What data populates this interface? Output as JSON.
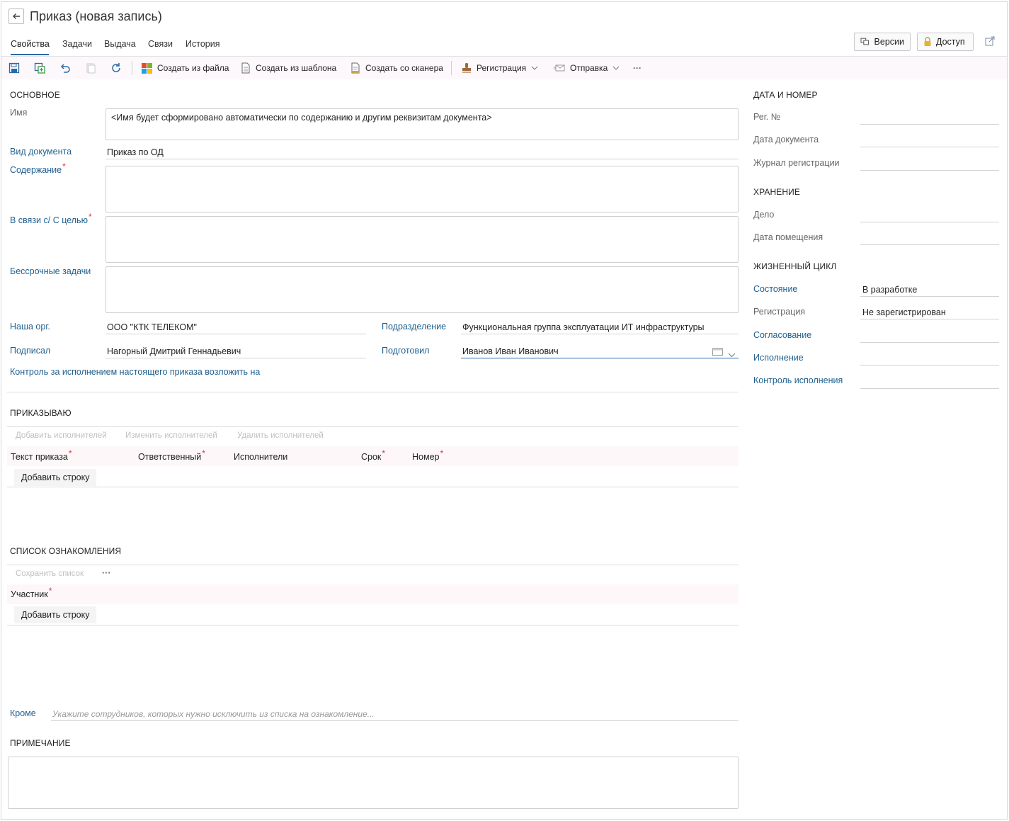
{
  "header": {
    "title": "Приказ (новая запись)",
    "versions_label": "Версии",
    "access_label": "Доступ"
  },
  "tabs": [
    {
      "label": "Свойства",
      "active": true
    },
    {
      "label": "Задачи"
    },
    {
      "label": "Выдача"
    },
    {
      "label": "Связи"
    },
    {
      "label": "История"
    }
  ],
  "toolbar": {
    "create_from_file": "Создать из файла",
    "create_from_template": "Создать из шаблона",
    "create_from_scanner": "Создать со сканера",
    "registration": "Регистрация",
    "sending": "Отправка",
    "more": "···"
  },
  "main": {
    "section_title": "ОСНОВНОЕ",
    "name_label": "Имя",
    "name_value": "<Имя будет сформировано автоматически по содержанию и другим реквизитам документа>",
    "doc_kind_label": "Вид документа",
    "doc_kind_value": "Приказ по ОД",
    "content_label": "Содержание",
    "purpose_label": "В связи с/ С целью",
    "perpetual_tasks_label": "Бессрочные задачи",
    "our_org_label": "Наша орг.",
    "our_org_value": "ООО \"КТК ТЕЛЕКОМ\"",
    "department_label": "Подразделение",
    "department_value": "Функциональная группа эксплуатации ИТ инфраструктуры",
    "signed_label": "Подписал",
    "signed_value": "Нагорный Дмитрий Геннадьевич",
    "prepared_label": "Подготовил",
    "prepared_value": "Иванов Иван Иванович",
    "control_label": "Контроль за исполнением настоящего приказа возложить на"
  },
  "orders": {
    "section_title": "ПРИКАЗЫВАЮ",
    "add_executor": "Добавить исполнителей",
    "change_executor": "Изменить исполнителей",
    "delete_executor": "Удалить исполнителей",
    "columns": [
      "Текст приказа",
      "Ответственный",
      "Исполнители",
      "Срок",
      "Номер"
    ],
    "add_row": "Добавить строку"
  },
  "acquaint": {
    "section_title": "СПИСОК ОЗНАКОМЛЕНИЯ",
    "save_list": "Сохранить список",
    "more": "···",
    "column": "Участник",
    "add_row": "Добавить строку",
    "except_label": "Кроме",
    "except_placeholder": "Укажите сотрудников, которых нужно исключить из списка на ознакомление..."
  },
  "note": {
    "section_title": "ПРИМЕЧАНИЕ"
  },
  "side": {
    "date_section": "ДАТА И НОМЕР",
    "reg_no_label": "Рег. №",
    "doc_date_label": "Дата документа",
    "reg_journal_label": "Журнал регистрации",
    "storage_section": "ХРАНЕНИЕ",
    "case_label": "Дело",
    "placement_date_label": "Дата помещения",
    "lifecycle_section": "ЖИЗНЕННЫЙ ЦИКЛ",
    "state_label": "Состояние",
    "state_value": "В разработке",
    "registration_label": "Регистрация",
    "registration_value": "Не зарегистрирован",
    "approval_label": "Согласование",
    "execution_label": "Исполнение",
    "exec_control_label": "Контроль исполнения"
  }
}
